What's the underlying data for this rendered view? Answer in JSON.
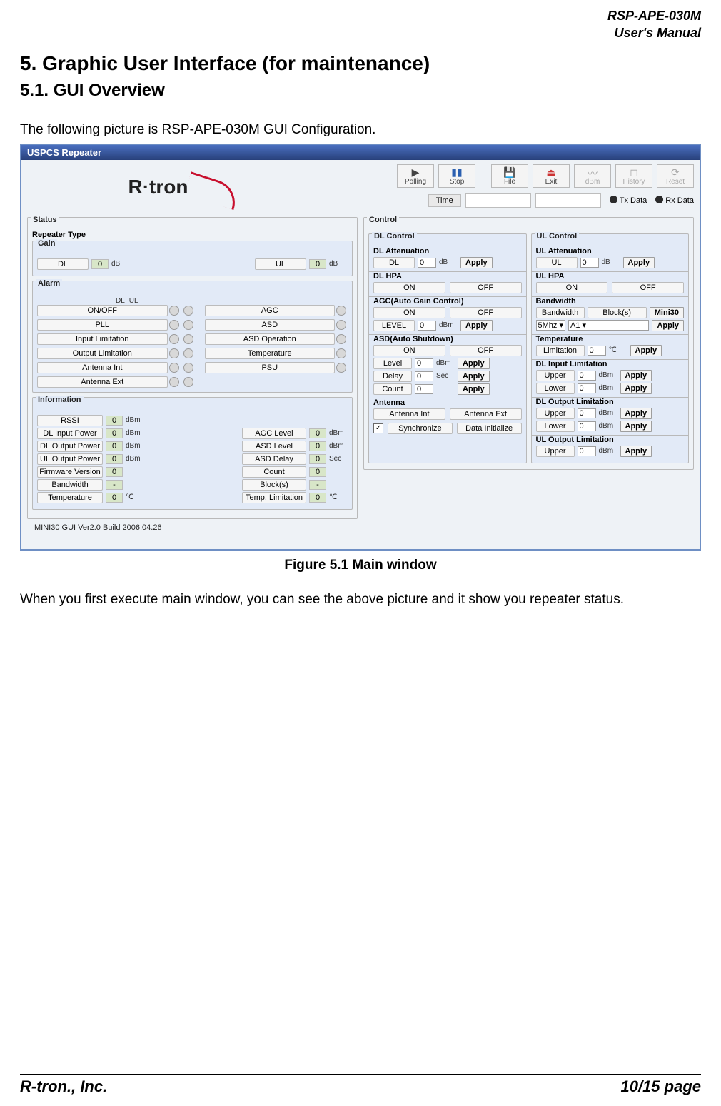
{
  "doc": {
    "product": "RSP-APE-030M",
    "manual": "User's Manual",
    "h1": "5. Graphic User Interface (for maintenance)",
    "h2": "5.1. GUI Overview",
    "intro": "The following picture is RSP-APE-030M GUI Configuration.",
    "figure_caption": "Figure 5.1 Main window",
    "after": "When you first execute main window, you can see the above picture and it show you repeater status.",
    "footer_left": "R-tron., Inc.",
    "footer_right": "10/15 page"
  },
  "gui": {
    "title": "USPCS Repeater",
    "logo": "R·tron",
    "toolbar": {
      "polling": "Polling",
      "stop": "Stop",
      "file": "File",
      "exit": "Exit",
      "dbm": "dBm",
      "history": "History",
      "reset": "Reset"
    },
    "timebar": {
      "time_label": "Time",
      "tx": "Tx Data",
      "rx": "Rx Data"
    },
    "status": {
      "legend": "Status",
      "repeater_type": "Repeater Type",
      "gain": {
        "legend": "Gain",
        "dl": "DL",
        "dl_val": "0",
        "dl_unit": "dB",
        "ul": "UL",
        "ul_val": "0",
        "ul_unit": "dB"
      },
      "alarm": {
        "legend": "Alarm",
        "dl": "DL",
        "ul": "UL",
        "items_left": [
          "ON/OFF",
          "PLL",
          "Input Limitation",
          "Output Limitation",
          "Antenna Int",
          "Antenna Ext"
        ],
        "items_right": [
          "AGC",
          "ASD",
          "ASD Operation",
          "Temperature",
          "PSU"
        ]
      },
      "info": {
        "legend": "Information",
        "rows_left": [
          {
            "label": "RSSI",
            "val": "0",
            "unit": "dBm"
          },
          {
            "label": "DL Input Power",
            "val": "0",
            "unit": "dBm"
          },
          {
            "label": "DL Output Power",
            "val": "0",
            "unit": "dBm"
          },
          {
            "label": "UL Output Power",
            "val": "0",
            "unit": "dBm"
          },
          {
            "label": "Firmware Version",
            "val": "0",
            "unit": ""
          },
          {
            "label": "Bandwidth",
            "val": "-",
            "unit": ""
          },
          {
            "label": "Temperature",
            "val": "0",
            "unit": "℃"
          }
        ],
        "rows_right": [
          {
            "label": "",
            "val": "",
            "unit": ""
          },
          {
            "label": "AGC Level",
            "val": "0",
            "unit": "dBm"
          },
          {
            "label": "ASD Level",
            "val": "0",
            "unit": "dBm"
          },
          {
            "label": "ASD Delay",
            "val": "0",
            "unit": "Sec"
          },
          {
            "label": "Count",
            "val": "0",
            "unit": ""
          },
          {
            "label": "Block(s)",
            "val": "-",
            "unit": ""
          },
          {
            "label": "Temp. Limitation",
            "val": "0",
            "unit": "℃"
          }
        ]
      },
      "version": "MINI30 GUI Ver2.0  Build 2006.04.26"
    },
    "control": {
      "legend": "Control",
      "dl": {
        "legend": "DL Control",
        "att": {
          "legend": "DL Attenuation",
          "label": "DL",
          "val": "0",
          "unit": "dB",
          "apply": "Apply"
        },
        "hpa": {
          "legend": "DL HPA",
          "on": "ON",
          "off": "OFF"
        },
        "agc": {
          "legend": "AGC(Auto Gain Control)",
          "on": "ON",
          "off": "OFF",
          "level": "LEVEL",
          "val": "0",
          "unit": "dBm",
          "apply": "Apply"
        },
        "asd": {
          "legend": "ASD(Auto Shutdown)",
          "on": "ON",
          "off": "OFF",
          "rows": [
            {
              "label": "Level",
              "val": "0",
              "unit": "dBm",
              "apply": "Apply"
            },
            {
              "label": "Delay",
              "val": "0",
              "unit": "Sec",
              "apply": "Apply"
            },
            {
              "label": "Count",
              "val": "0",
              "unit": "",
              "apply": "Apply"
            }
          ]
        },
        "ant": {
          "legend": "Antenna",
          "int": "Antenna Int",
          "ext": "Antenna Ext"
        },
        "sync": {
          "check": "✓",
          "sync": "Synchronize",
          "init": "Data Initialize"
        }
      },
      "ul": {
        "legend": "UL Control",
        "att": {
          "legend": "UL Attenuation",
          "label": "UL",
          "val": "0",
          "unit": "dB",
          "apply": "Apply"
        },
        "hpa": {
          "legend": "UL HPA",
          "on": "ON",
          "off": "OFF"
        },
        "bw": {
          "legend": "Bandwidth",
          "bandwidth": "Bandwidth",
          "blocks": "Block(s)",
          "mini": "Mini30",
          "sel1": "5Mhz",
          "sel2": "A1",
          "apply": "Apply"
        },
        "temp": {
          "legend": "Temperature",
          "label": "Limitation",
          "val": "0",
          "unit": "℃",
          "apply": "Apply"
        },
        "dlin": {
          "legend": "DL Input Limitation",
          "rows": [
            {
              "label": "Upper",
              "val": "0",
              "unit": "dBm",
              "apply": "Apply"
            },
            {
              "label": "Lower",
              "val": "0",
              "unit": "dBm",
              "apply": "Apply"
            }
          ]
        },
        "dlout": {
          "legend": "DL Output Limitation",
          "rows": [
            {
              "label": "Upper",
              "val": "0",
              "unit": "dBm",
              "apply": "Apply"
            },
            {
              "label": "Lower",
              "val": "0",
              "unit": "dBm",
              "apply": "Apply"
            }
          ]
        },
        "ulout": {
          "legend": "UL Output Limitation",
          "rows": [
            {
              "label": "Upper",
              "val": "0",
              "unit": "dBm",
              "apply": "Apply"
            }
          ]
        }
      }
    }
  }
}
